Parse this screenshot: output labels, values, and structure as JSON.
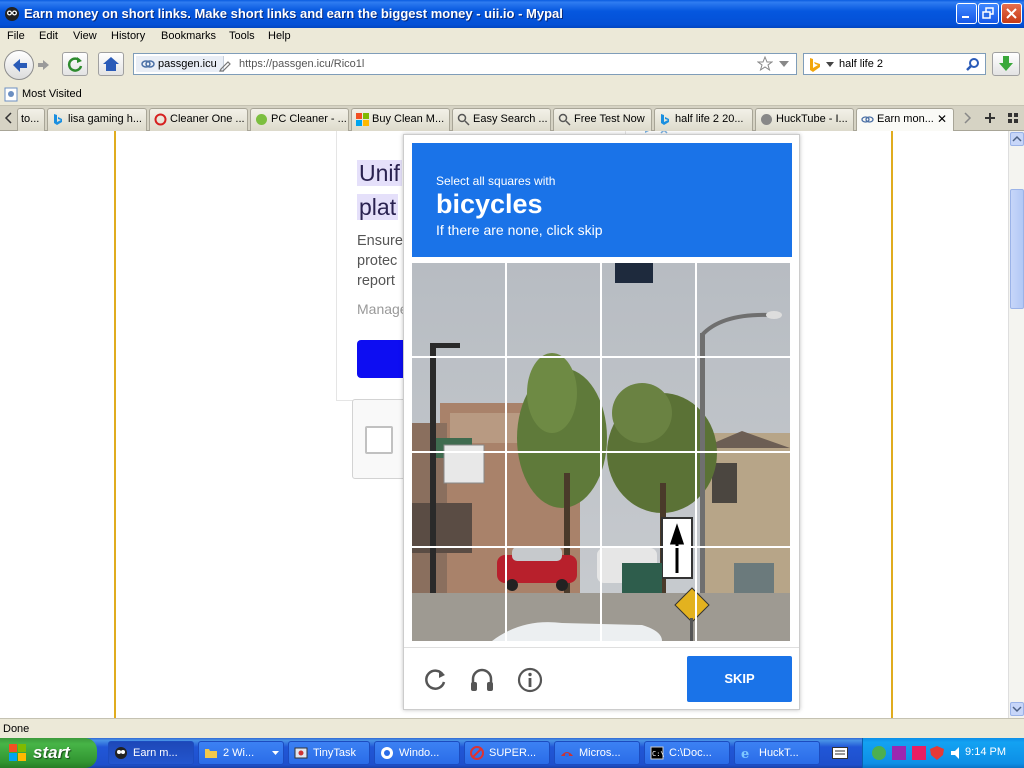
{
  "window": {
    "title": "Earn money on short links. Make short links and earn the biggest money - uii.io - Mypal"
  },
  "menu": [
    "File",
    "Edit",
    "View",
    "History",
    "Bookmarks",
    "Tools",
    "Help"
  ],
  "address": {
    "site_identity": "passgen.icu",
    "url": "https://passgen.icu/Rico1l"
  },
  "search": {
    "query": "half life 2"
  },
  "bookmarks": {
    "most_visited": "Most Visited"
  },
  "tabs": [
    {
      "label": "to..."
    },
    {
      "label": "lisa gaming h..."
    },
    {
      "label": "Cleaner One ..."
    },
    {
      "label": "PC Cleaner - ..."
    },
    {
      "label": "Buy Clean M..."
    },
    {
      "label": "Easy Search ..."
    },
    {
      "label": "Free Test Now"
    },
    {
      "label": "half life 2 20..."
    },
    {
      "label": "HuckTube - I..."
    },
    {
      "label": "Earn mon..."
    }
  ],
  "page": {
    "headline_1": "Unif",
    "headline_2": "plat",
    "sub_1": "Ensure",
    "sub_2": "protec",
    "sub_3": "report",
    "manage": "Manage"
  },
  "captcha": {
    "instruction": "Select all squares with",
    "target": "bicycles",
    "hint": "If there are none, click skip",
    "skip_label": "SKIP"
  },
  "status": {
    "text": "Done"
  },
  "taskbar": {
    "start_label": "start",
    "tasks": [
      {
        "label": "Earn m..."
      },
      {
        "label": "2 Wi..."
      },
      {
        "label": "TinyTask"
      },
      {
        "label": "Windo..."
      },
      {
        "label": "SUPER..."
      },
      {
        "label": "Micros..."
      },
      {
        "label": "C:\\Doc..."
      },
      {
        "label": "HuckT..."
      }
    ],
    "clock": "9:14 PM"
  },
  "colors": {
    "captcha_blue": "#1a73e8",
    "cta_blue": "#0d0df2",
    "accent_gold": "#e0ac1f"
  }
}
